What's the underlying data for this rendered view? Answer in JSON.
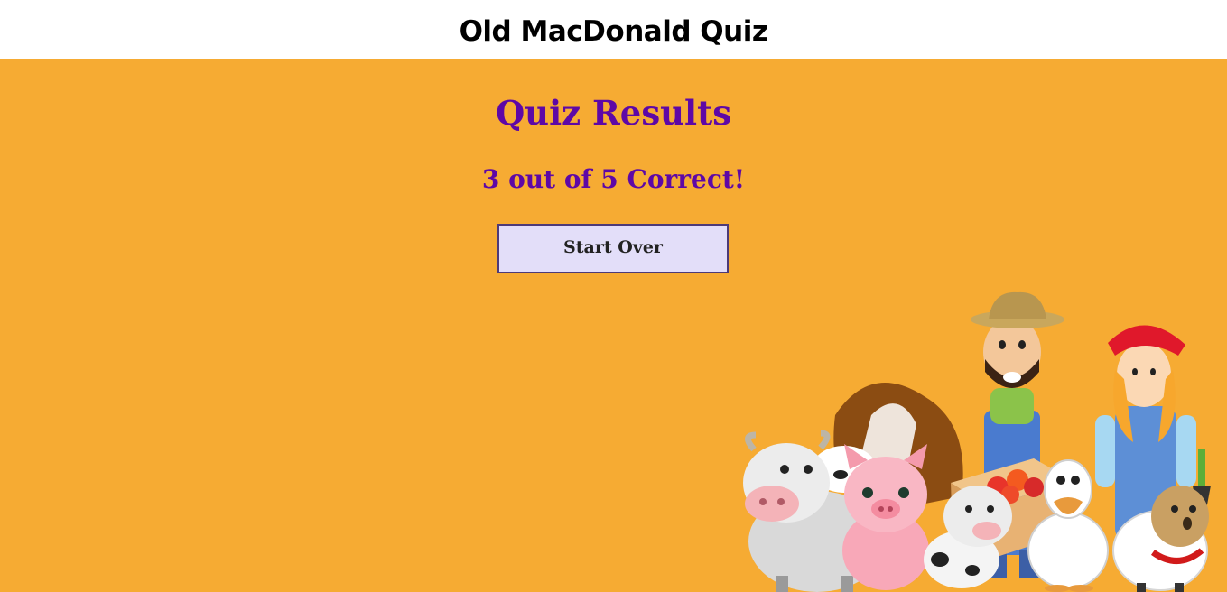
{
  "header": {
    "title": "Old MacDonald Quiz"
  },
  "results": {
    "heading": "Quiz Results",
    "score_text": "3 out of 5 Correct!",
    "correct": 3,
    "total": 5,
    "start_over_label": "Start Over"
  },
  "colors": {
    "background": "#f6ab33",
    "heading": "#5e08a6",
    "button_bg": "#e3def9",
    "button_border": "#4d3a78"
  },
  "illustration": {
    "icon": "farm-animals-illustration"
  }
}
